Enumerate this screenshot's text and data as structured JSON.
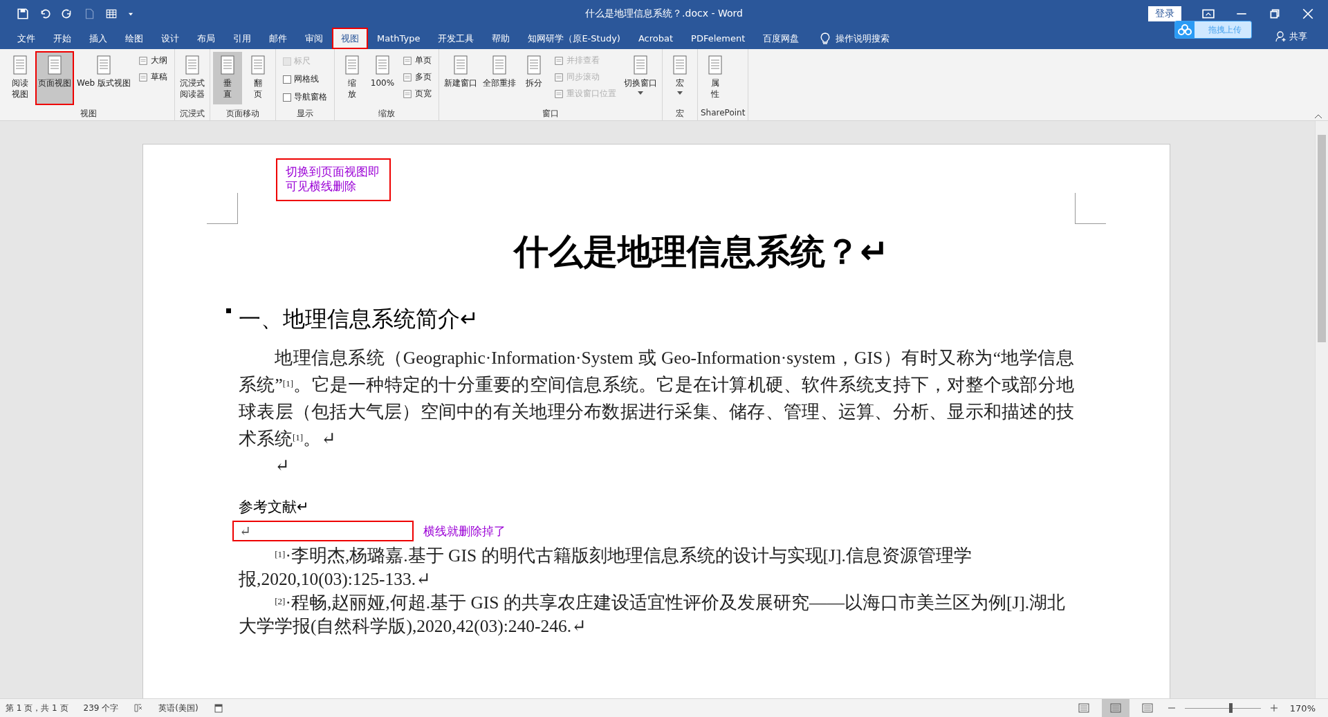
{
  "window": {
    "title": "什么是地理信息系统？.docx  -  Word",
    "login": "登录"
  },
  "upload": {
    "label": "拖拽上传"
  },
  "share": {
    "label": "共享"
  },
  "tabs": [
    {
      "label": "文件",
      "selected": false,
      "annotated": false
    },
    {
      "label": "开始",
      "selected": false,
      "annotated": false
    },
    {
      "label": "插入",
      "selected": false,
      "annotated": false
    },
    {
      "label": "绘图",
      "selected": false,
      "annotated": false
    },
    {
      "label": "设计",
      "selected": false,
      "annotated": false
    },
    {
      "label": "布局",
      "selected": false,
      "annotated": false
    },
    {
      "label": "引用",
      "selected": false,
      "annotated": false
    },
    {
      "label": "邮件",
      "selected": false,
      "annotated": false
    },
    {
      "label": "审阅",
      "selected": false,
      "annotated": false
    },
    {
      "label": "视图",
      "selected": true,
      "annotated": true
    },
    {
      "label": "MathType",
      "selected": false,
      "annotated": false
    },
    {
      "label": "开发工具",
      "selected": false,
      "annotated": false
    },
    {
      "label": "帮助",
      "selected": false,
      "annotated": false
    },
    {
      "label": "知网研学（原E-Study)",
      "selected": false,
      "annotated": false
    },
    {
      "label": "Acrobat",
      "selected": false,
      "annotated": false
    },
    {
      "label": "PDFelement",
      "selected": false,
      "annotated": false
    },
    {
      "label": "百度网盘",
      "selected": false,
      "annotated": false
    }
  ],
  "tell_me": {
    "placeholder": "操作说明搜索"
  },
  "ribbon": [
    {
      "label": "视图",
      "items": [
        {
          "kind": "large",
          "lines": [
            "阅读",
            "视图"
          ],
          "selected": false,
          "annotated": false
        },
        {
          "kind": "large",
          "lines": [
            "页面视图"
          ],
          "selected": true,
          "annotated": true
        },
        {
          "kind": "large",
          "lines": [
            "Web 版式视图"
          ],
          "selected": false,
          "annotated": false
        },
        {
          "kind": "stack",
          "items": [
            {
              "kind": "small",
              "label": "大纲",
              "disabled": false
            },
            {
              "kind": "small",
              "label": "草稿",
              "disabled": false
            }
          ]
        }
      ]
    },
    {
      "label": "沉浸式",
      "items": [
        {
          "kind": "large",
          "lines": [
            "沉浸式",
            "阅读器"
          ],
          "selected": false,
          "annotated": false
        }
      ]
    },
    {
      "label": "页面移动",
      "items": [
        {
          "kind": "large",
          "lines": [
            "垂",
            "直"
          ],
          "selected": true,
          "annotated": false
        },
        {
          "kind": "large",
          "lines": [
            "翻",
            "页"
          ],
          "selected": false,
          "annotated": false
        }
      ]
    },
    {
      "label": "显示",
      "items": [
        {
          "kind": "stack",
          "items": [
            {
              "kind": "check",
              "label": "标尺",
              "checked": false,
              "disabled": true
            },
            {
              "kind": "check",
              "label": "网格线",
              "checked": false,
              "disabled": false
            },
            {
              "kind": "check",
              "label": "导航窗格",
              "checked": false,
              "disabled": false
            }
          ]
        }
      ]
    },
    {
      "label": "缩放",
      "items": [
        {
          "kind": "large",
          "lines": [
            "缩",
            "放"
          ],
          "selected": false,
          "annotated": false
        },
        {
          "kind": "large",
          "lines": [
            "100%"
          ],
          "selected": false,
          "annotated": false
        },
        {
          "kind": "stack",
          "items": [
            {
              "kind": "small",
              "label": "单页",
              "disabled": false
            },
            {
              "kind": "small",
              "label": "多页",
              "disabled": false
            },
            {
              "kind": "small",
              "label": "页宽",
              "disabled": false
            }
          ]
        }
      ]
    },
    {
      "label": "窗口",
      "items": [
        {
          "kind": "large",
          "lines": [
            "新建窗口"
          ],
          "selected": false,
          "annotated": false
        },
        {
          "kind": "large",
          "lines": [
            "全部重排"
          ],
          "selected": false,
          "annotated": false
        },
        {
          "kind": "large",
          "lines": [
            "拆分"
          ],
          "selected": false,
          "annotated": false
        },
        {
          "kind": "stack",
          "items": [
            {
              "kind": "small",
              "label": "并排查看",
              "disabled": true
            },
            {
              "kind": "small",
              "label": "同步滚动",
              "disabled": true
            },
            {
              "kind": "small",
              "label": "重设窗口位置",
              "disabled": true
            }
          ]
        },
        {
          "kind": "large",
          "lines": [
            "切换窗口"
          ],
          "selected": false,
          "annotated": false,
          "dropdown": true
        }
      ]
    },
    {
      "label": "宏",
      "items": [
        {
          "kind": "large",
          "lines": [
            "宏"
          ],
          "selected": false,
          "annotated": false,
          "dropdown": true
        }
      ]
    },
    {
      "label": "SharePoint",
      "items": [
        {
          "kind": "large",
          "lines": [
            "属",
            "性"
          ],
          "selected": false,
          "annotated": false
        }
      ]
    }
  ],
  "document": {
    "note_top": [
      "切换到页面视图即",
      "可见横线删除"
    ],
    "title": "什么是地理信息系统？↵",
    "heading": "一、地理信息系统简介↵",
    "paragraphs": [
      {
        "kind": "body",
        "text": "地理信息系统（Geographic·Information·System 或 Geo-Information·system，GIS）有时又称为“地学信息系统”$^{[1]}$。它是一种特定的十分重要的空间信息系统。它是在计算机硬、软件系统支持下，对整个或部分地球表层（包括大气层）空间中的有关地理分布数据进行采集、储存、管理、运算、分析、显示和描述的技术系统$^{[1]}$。↵"
      },
      {
        "kind": "body",
        "text": "↵"
      },
      {
        "kind": "subhead",
        "text": "参考文献↵"
      },
      {
        "kind": "separator",
        "text": "↵",
        "note": "横线就删除掉了"
      },
      {
        "kind": "body",
        "text": "$^{[1]}$·李明杰,杨璐嘉.基于 GIS 的明代古籍版刻地理信息系统的设计与实现[J].信息资源管理学报,2020,10(03):125-133.↵"
      },
      {
        "kind": "body",
        "text": "$^{[2]}$·程畅,赵丽娅,何超.基于 GIS 的共享农庄建设适宜性评价及发展研究——以海口市美兰区为例[J].湖北大学学报(自然科学版),2020,42(03):240-246.↵"
      }
    ]
  },
  "status_bar": {
    "page": "第 1 页，共 1 页",
    "words": "239 个字",
    "language": "英语(美国)",
    "zoom": "170%",
    "zoom_slider": {
      "level": 0.6
    },
    "views": [
      {
        "selected": false
      },
      {
        "selected": true
      },
      {
        "selected": false
      }
    ]
  }
}
